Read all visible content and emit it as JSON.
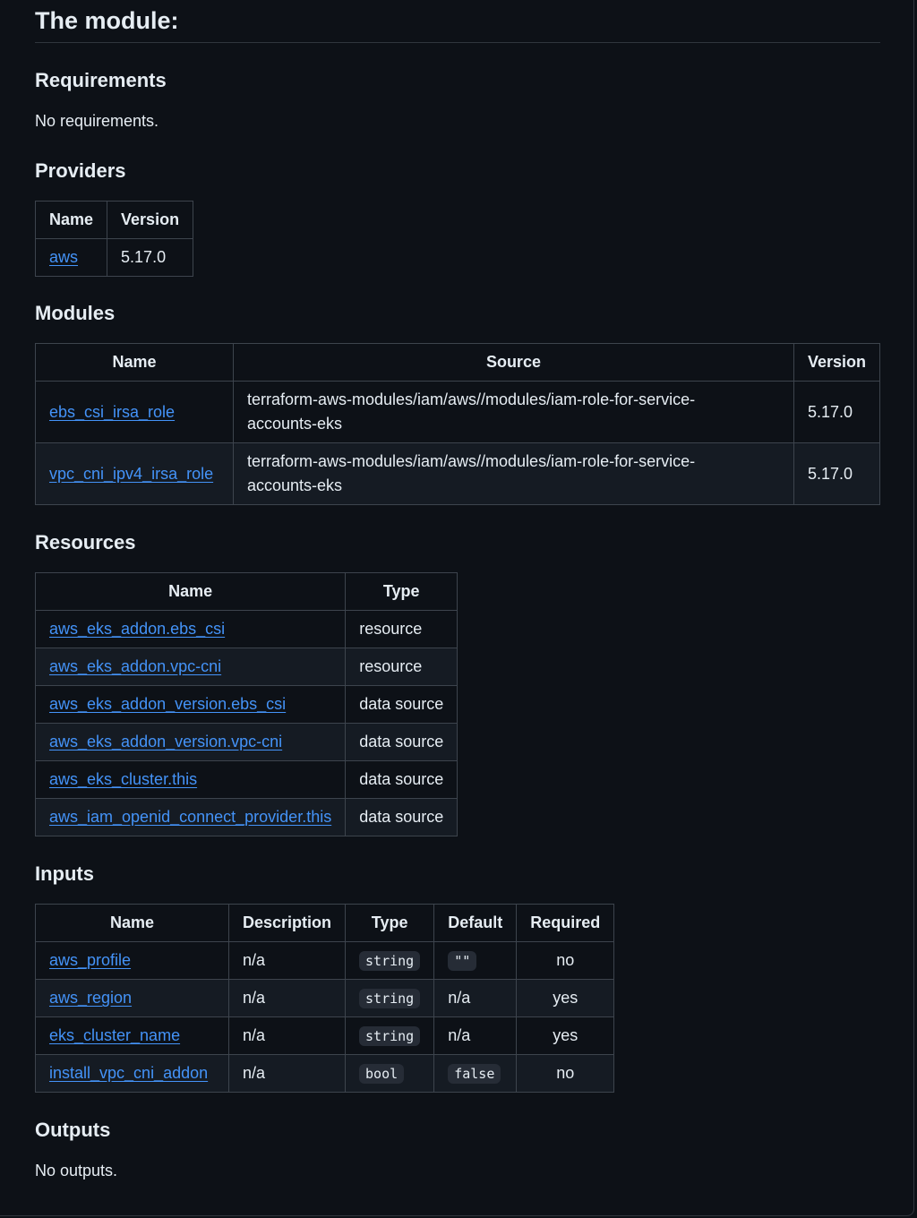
{
  "title": "The module:",
  "requirements": {
    "heading": "Requirements",
    "text": "No requirements."
  },
  "providers": {
    "heading": "Providers",
    "columns": [
      "Name",
      "Version"
    ],
    "rows": [
      {
        "name": "aws",
        "version": "5.17.0"
      }
    ]
  },
  "modules": {
    "heading": "Modules",
    "columns": [
      "Name",
      "Source",
      "Version"
    ],
    "rows": [
      {
        "name": "ebs_csi_irsa_role",
        "source_line1": "terraform-aws-modules/iam/aws//modules/iam-role-for-service-",
        "source_line2": "accounts-eks",
        "version": "5.17.0"
      },
      {
        "name": "vpc_cni_ipv4_irsa_role",
        "source_line1": "terraform-aws-modules/iam/aws//modules/iam-role-for-service-",
        "source_line2": "accounts-eks",
        "version": "5.17.0"
      }
    ]
  },
  "resources": {
    "heading": "Resources",
    "columns": [
      "Name",
      "Type"
    ],
    "rows": [
      {
        "name": "aws_eks_addon.ebs_csi",
        "type": "resource"
      },
      {
        "name": "aws_eks_addon.vpc-cni",
        "type": "resource"
      },
      {
        "name": "aws_eks_addon_version.ebs_csi",
        "type": "data source"
      },
      {
        "name": "aws_eks_addon_version.vpc-cni",
        "type": "data source"
      },
      {
        "name": "aws_eks_cluster.this",
        "type": "data source"
      },
      {
        "name": "aws_iam_openid_connect_provider.this",
        "type": "data source"
      }
    ]
  },
  "inputs": {
    "heading": "Inputs",
    "columns": [
      "Name",
      "Description",
      "Type",
      "Default",
      "Required"
    ],
    "rows": [
      {
        "name": "aws_profile",
        "description": "n/a",
        "type": "string",
        "default": "\"\"",
        "default_is_code": true,
        "required": "no"
      },
      {
        "name": "aws_region",
        "description": "n/a",
        "type": "string",
        "default": "n/a",
        "default_is_code": false,
        "required": "yes"
      },
      {
        "name": "eks_cluster_name",
        "description": "n/a",
        "type": "string",
        "default": "n/a",
        "default_is_code": false,
        "required": "yes"
      },
      {
        "name": "install_vpc_cni_addon",
        "description": "n/a",
        "type": "bool",
        "default": "false",
        "default_is_code": true,
        "required": "no"
      }
    ]
  },
  "outputs": {
    "heading": "Outputs",
    "text": "No outputs."
  }
}
